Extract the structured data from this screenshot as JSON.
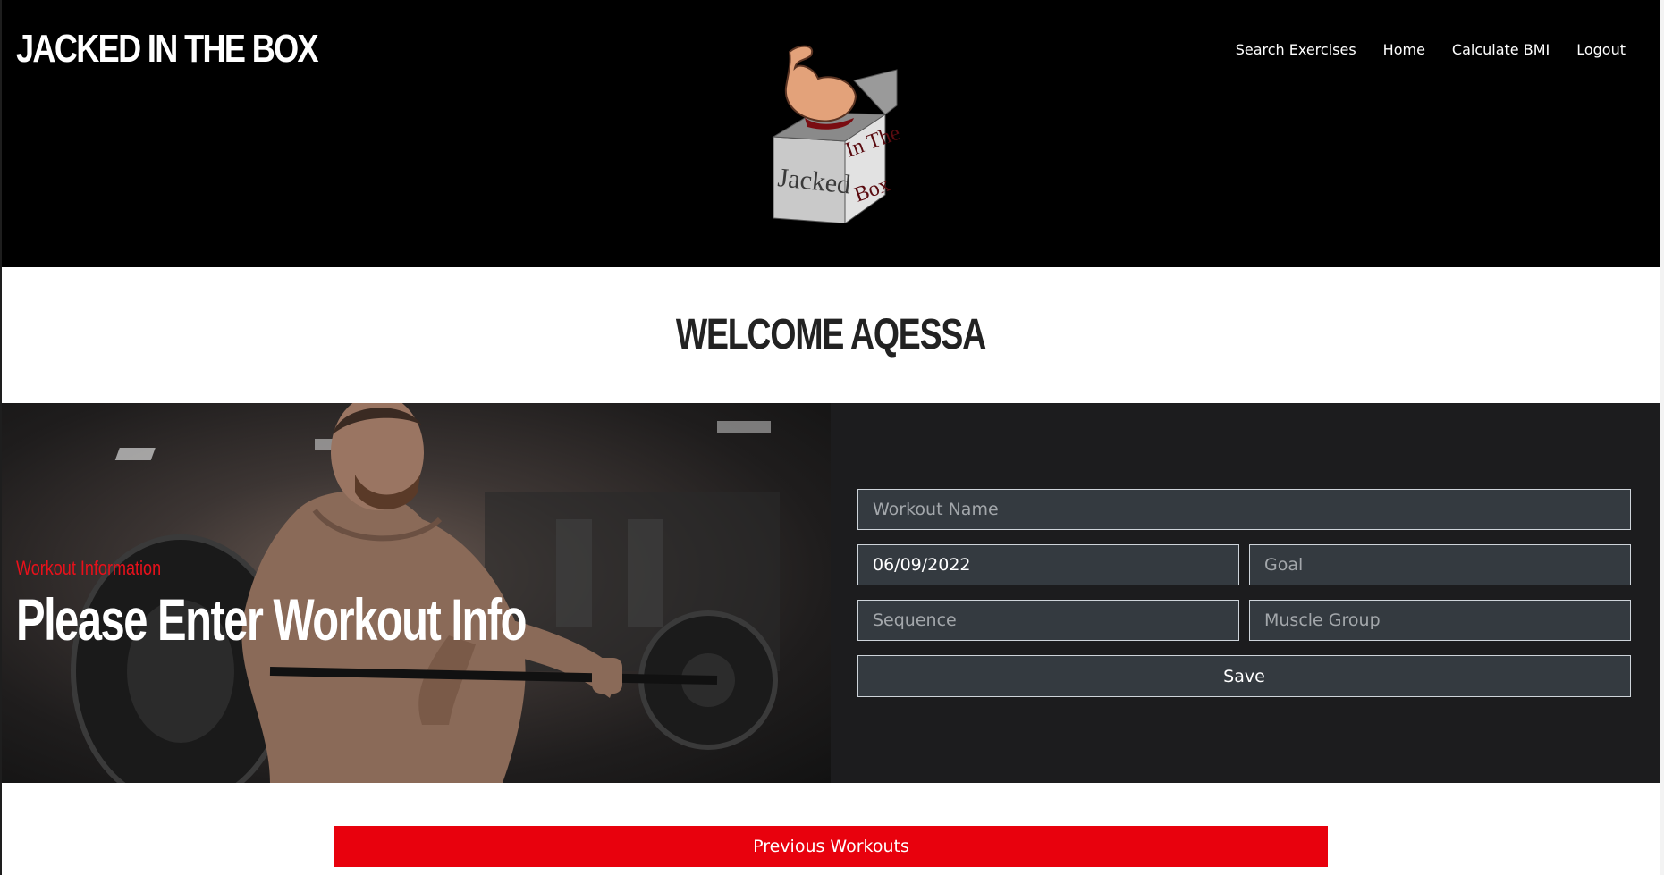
{
  "header": {
    "brand": "JACKED IN THE BOX",
    "nav": [
      "Search Exercises",
      "Home",
      "Calculate BMI",
      "Logout"
    ],
    "logo_text": [
      "Jacked",
      "In The",
      "Box"
    ]
  },
  "welcome": {
    "title": "WELCOME AQESSA"
  },
  "hero": {
    "subtitle": "Workout Information",
    "title": "Please Enter Workout Info"
  },
  "form": {
    "workout_name": {
      "value": "",
      "placeholder": "Workout Name"
    },
    "date": {
      "value": "06/09/2022",
      "placeholder": ""
    },
    "goal": {
      "value": "",
      "placeholder": "Goal"
    },
    "sequence": {
      "value": "",
      "placeholder": "Sequence"
    },
    "muscle_group": {
      "value": "",
      "placeholder": "Muscle Group"
    },
    "save_label": "Save"
  },
  "footer": {
    "previous_workouts_label": "Previous Workouts"
  },
  "colors": {
    "accent_red": "#e8010d",
    "header_bg": "#000000",
    "form_bg": "#1c1c1e",
    "field_bg": "#343a40"
  }
}
